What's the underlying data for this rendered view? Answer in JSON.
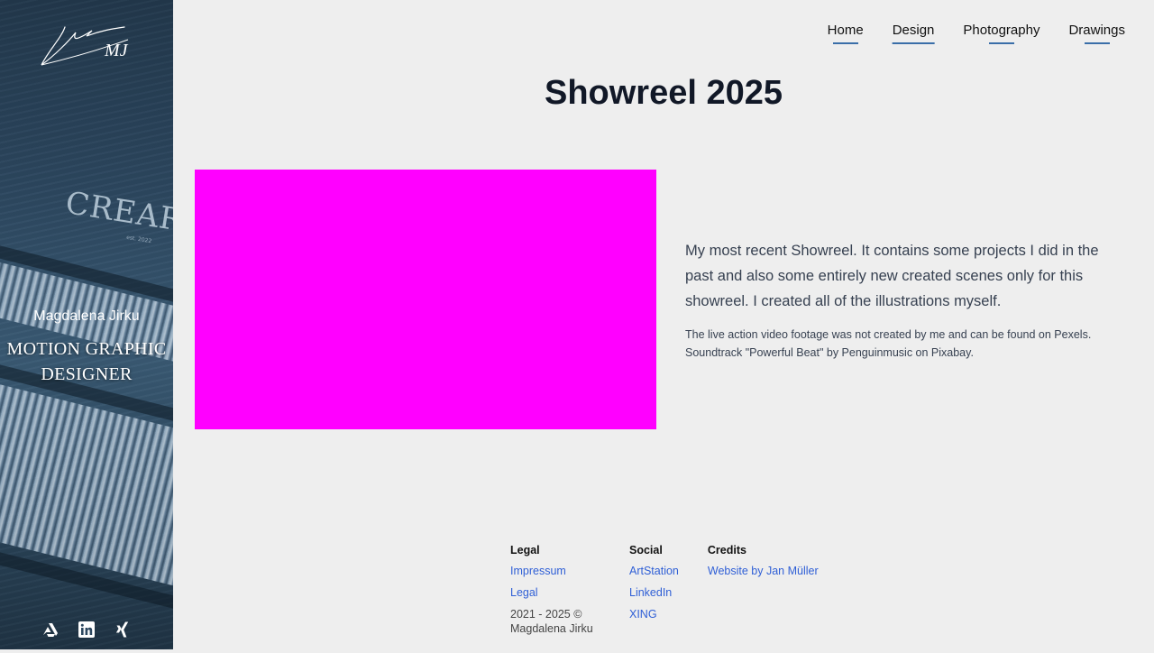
{
  "sidebar": {
    "logo_text": "MJ",
    "brand_text": "CREARTI",
    "brand_sub": "est. 2022",
    "name": "Magdalena Jirku",
    "role": "MOTION GRAPHIC DESIGNER",
    "socials": [
      {
        "icon": "artstation-icon"
      },
      {
        "icon": "linkedin-icon"
      },
      {
        "icon": "xing-icon"
      }
    ]
  },
  "nav": {
    "items": [
      {
        "label": "Home",
        "active": false
      },
      {
        "label": "Design",
        "active": true
      },
      {
        "label": "Photography",
        "active": false
      },
      {
        "label": "Drawings",
        "active": false
      }
    ]
  },
  "main": {
    "title": "Showreel 2025",
    "description": "My most recent Showreel. It contains some projects I did in the past and also some entirely new created scenes only for this showreel. I created all of the illustrations myself.",
    "note_line1": "The live action video footage was not created by me and can be found on Pexels.",
    "note_line2": "Soundtrack \"Powerful Beat\" by Penguinmusic on Pixabay."
  },
  "footer": {
    "legal": {
      "heading": "Legal",
      "links": [
        "Impressum",
        "Legal"
      ],
      "copyright": "2021 - 2025 © Magdalena Jirku"
    },
    "social": {
      "heading": "Social",
      "links": [
        "ArtStation",
        "LinkedIn",
        "XING"
      ]
    },
    "credits": {
      "heading": "Credits",
      "links": [
        "Website by Jan Müller"
      ]
    }
  },
  "colors": {
    "background": "#eeeeee",
    "accent_underline": "#3a6ea8",
    "link": "#2f5fd6",
    "video_placeholder": "#ff00ff",
    "sidebar": "#2d4860"
  }
}
